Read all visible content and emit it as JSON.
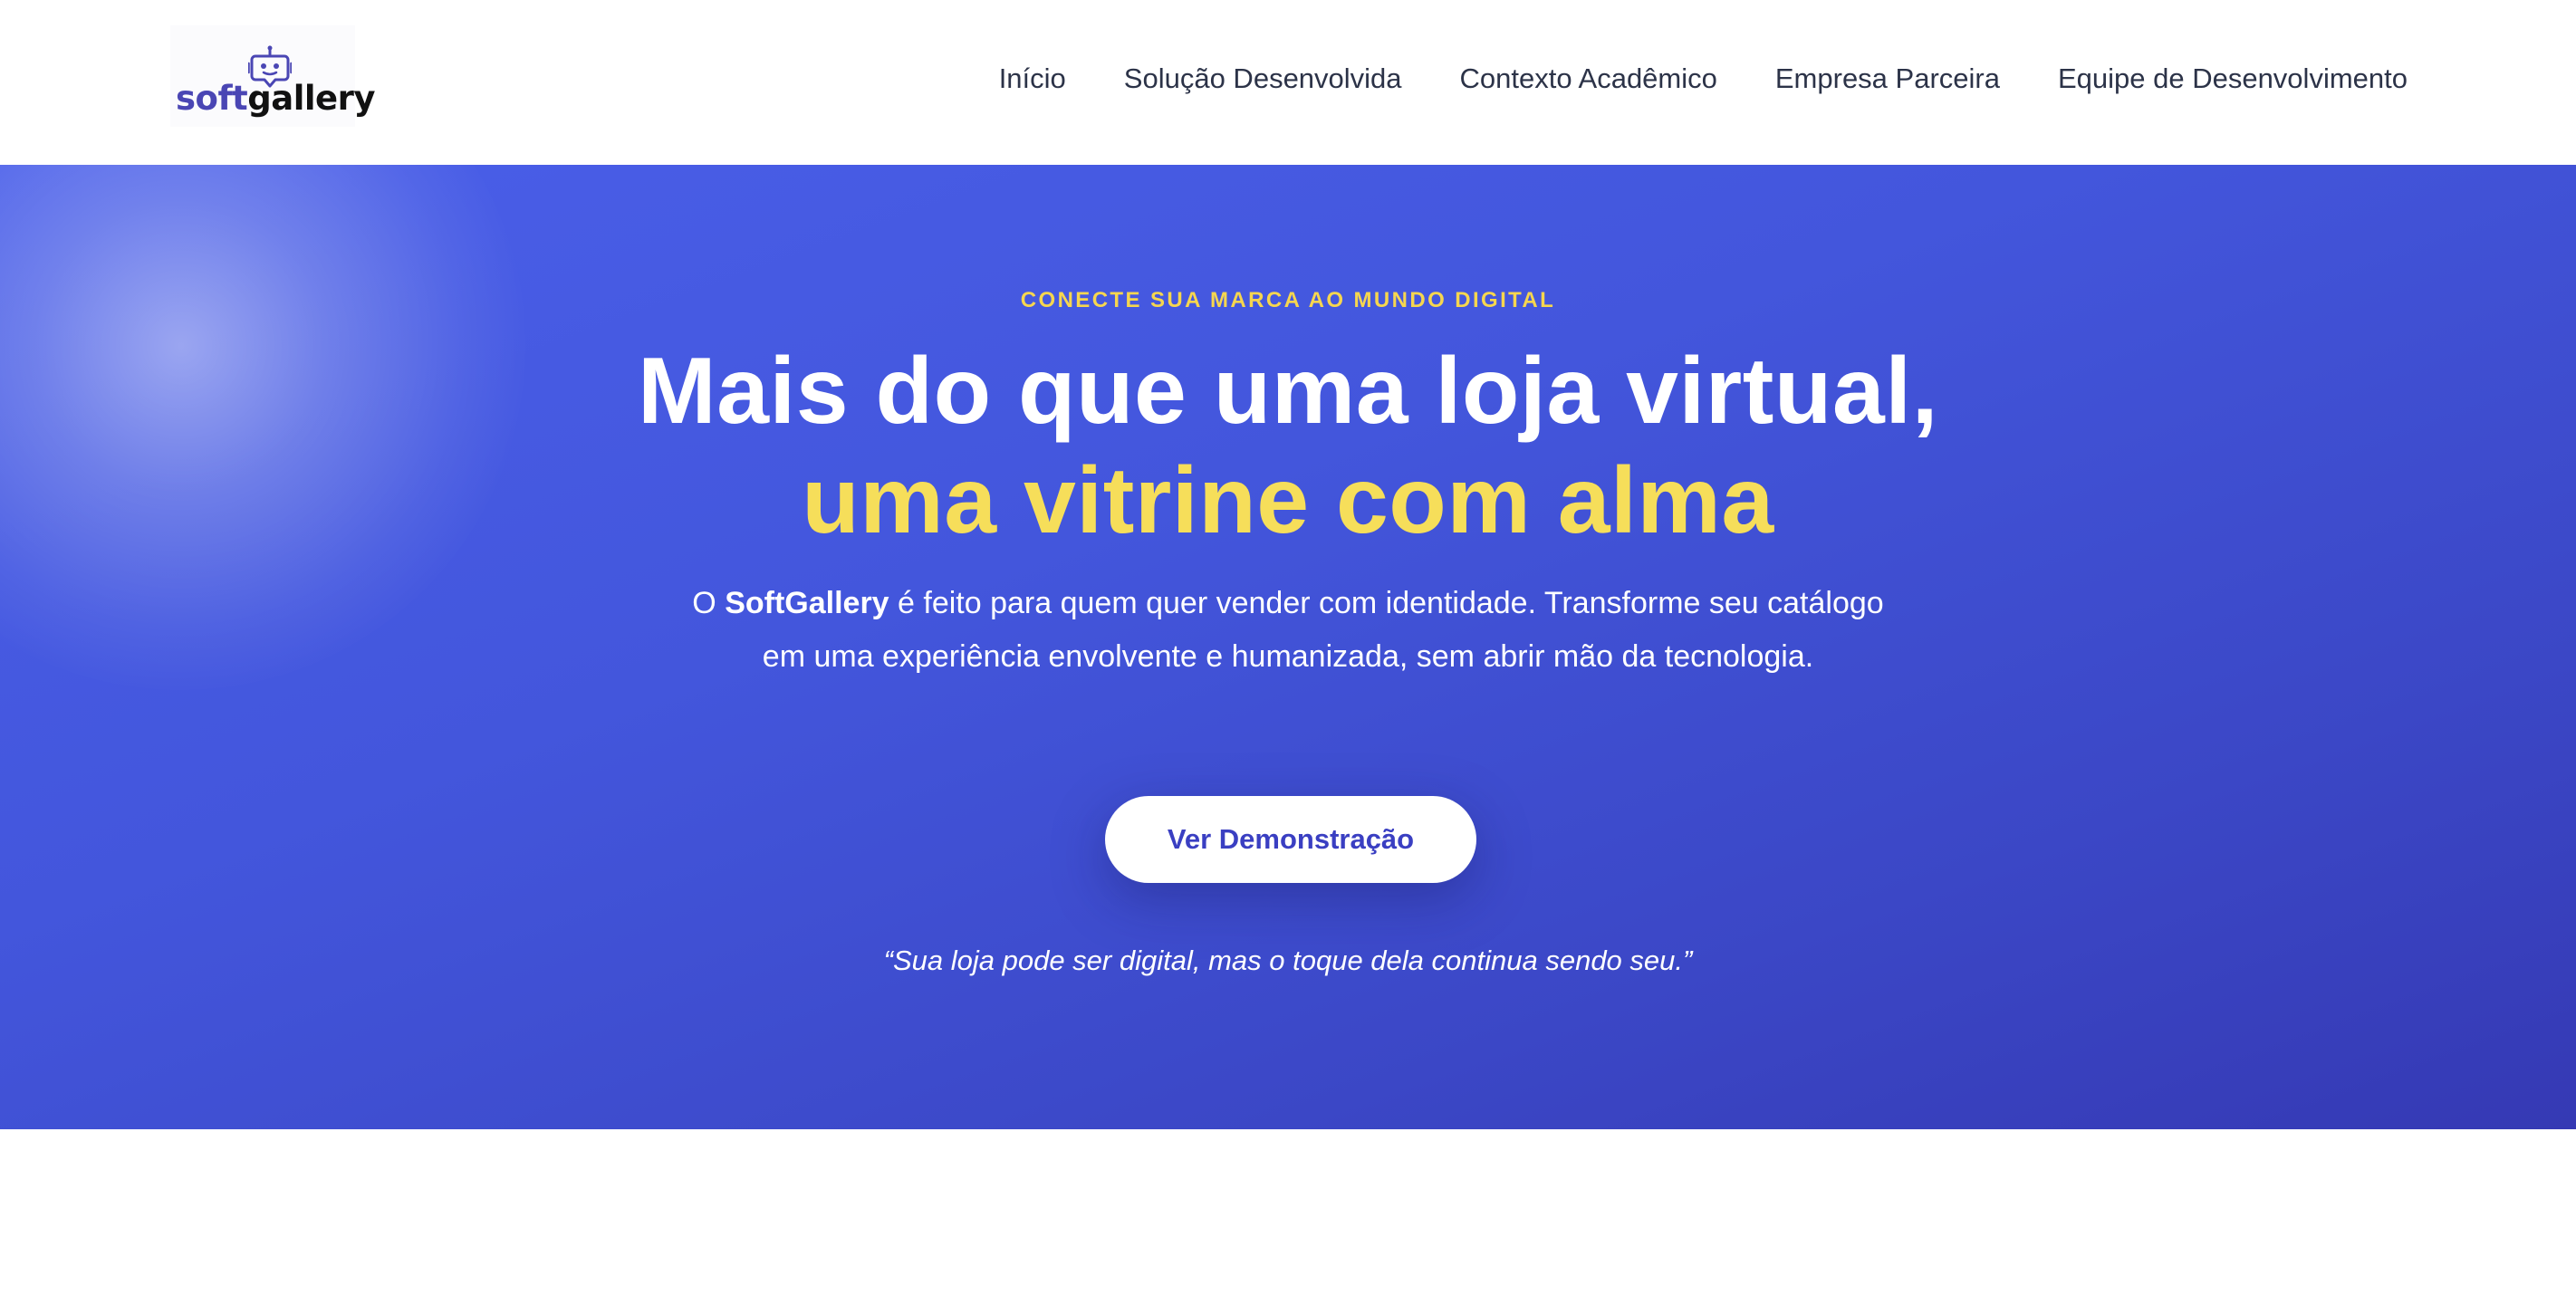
{
  "header": {
    "logo": {
      "icon": "robot-chat-icon",
      "word_soft": "soft",
      "word_gallery": "gallery",
      "brand_color": "#4a46b4"
    },
    "nav": [
      {
        "label": "Início"
      },
      {
        "label": "Solução Desenvolvida"
      },
      {
        "label": "Contexto Acadêmico"
      },
      {
        "label": "Empresa Parceira"
      },
      {
        "label": "Equipe de Desenvolvimento"
      }
    ]
  },
  "hero": {
    "eyebrow": "CONECTE SUA MARCA AO MUNDO DIGITAL",
    "title_line1": "Mais do que uma loja virtual,",
    "title_line2": "uma vitrine com alma",
    "desc_prefix": "O ",
    "desc_brand": "SoftGallery",
    "desc_rest": " é feito para quem quer vender com identidade. Transforme seu catálogo em uma experiência envolvente e humanizada, sem abrir mão da tecnologia.",
    "cta_label": "Ver Demonstração",
    "quote": "“Sua loja pode ser digital, mas o toque dela continua sendo seu.”",
    "colors": {
      "background": "#4356dc",
      "accent": "#f6de5a",
      "button_text": "#3a3fc2"
    }
  }
}
